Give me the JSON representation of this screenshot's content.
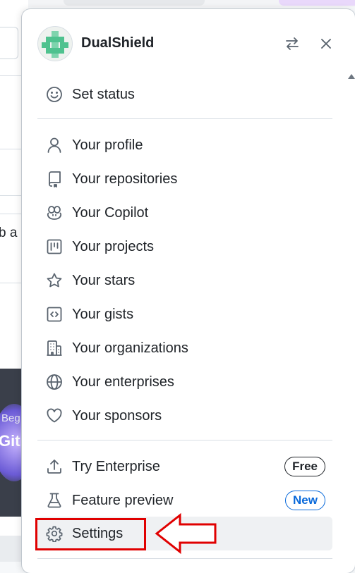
{
  "background": {
    "partial_text": "b a",
    "card_text_1": "Beg",
    "card_text_2": "Git"
  },
  "header": {
    "username": "DualShield",
    "switch_account_icon": "arrow-switch-icon",
    "close_icon": "x-icon"
  },
  "menu": {
    "set_status": "Set status",
    "your_profile": "Your profile",
    "your_repositories": "Your repositories",
    "your_copilot": "Your Copilot",
    "your_projects": "Your projects",
    "your_stars": "Your stars",
    "your_gists": "Your gists",
    "your_organizations": "Your organizations",
    "your_enterprises": "Your enterprises",
    "your_sponsors": "Your sponsors",
    "try_enterprise": "Try Enterprise",
    "try_enterprise_badge": "Free",
    "feature_preview": "Feature preview",
    "feature_preview_badge": "New",
    "settings": "Settings"
  },
  "colors": {
    "annotation": "#e00000",
    "accent_blue": "#0969da",
    "avatar_green": "#4fc28f"
  }
}
